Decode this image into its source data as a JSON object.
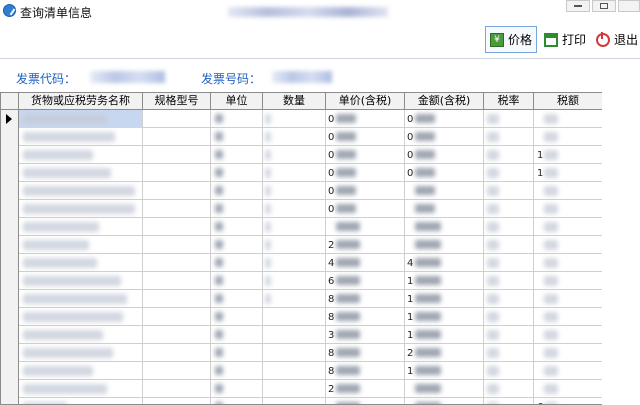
{
  "window": {
    "title": "查询清单信息",
    "controls": [
      "minimize",
      "maximize",
      "close"
    ]
  },
  "toolbar": {
    "price_label": "价格",
    "print_label": "打印",
    "exit_label": "退出"
  },
  "invoice": {
    "code_label": "发票代码：",
    "number_label": "发票号码："
  },
  "table": {
    "columns": [
      "货物或应税劳务名称",
      "规格型号",
      "单位",
      "数量",
      "单价(含税)",
      "金额(含税)",
      "税率",
      "税额"
    ],
    "rows": [
      {
        "price_hint": "0",
        "amount_hint": "0",
        "tax_hint": ""
      },
      {
        "price_hint": "0",
        "amount_hint": "0",
        "tax_hint": ""
      },
      {
        "price_hint": "0",
        "amount_hint": "0",
        "tax_hint": "1"
      },
      {
        "price_hint": "0",
        "amount_hint": "0",
        "tax_hint": "1"
      },
      {
        "price_hint": "0",
        "amount_hint": "",
        "tax_hint": ""
      },
      {
        "price_hint": "0",
        "amount_hint": "",
        "tax_hint": ""
      },
      {
        "price_hint": "",
        "amount_hint": "",
        "tax_hint": ""
      },
      {
        "price_hint": "2",
        "amount_hint": "",
        "tax_hint": ""
      },
      {
        "price_hint": "4",
        "amount_hint": "4",
        "tax_hint": ""
      },
      {
        "price_hint": "6",
        "amount_hint": "1",
        "tax_hint": ""
      },
      {
        "price_hint": "8",
        "amount_hint": "1",
        "tax_hint": ""
      },
      {
        "price_hint": "8",
        "amount_hint": "1",
        "tax_hint": ""
      },
      {
        "price_hint": "3",
        "amount_hint": "1",
        "tax_hint": ""
      },
      {
        "price_hint": "8",
        "amount_hint": "2",
        "tax_hint": ""
      },
      {
        "price_hint": "8",
        "amount_hint": "1",
        "tax_hint": ""
      },
      {
        "price_hint": "2",
        "amount_hint": "",
        "tax_hint": ""
      },
      {
        "price_hint": "",
        "amount_hint": "",
        "tax_hint": "6"
      }
    ]
  }
}
